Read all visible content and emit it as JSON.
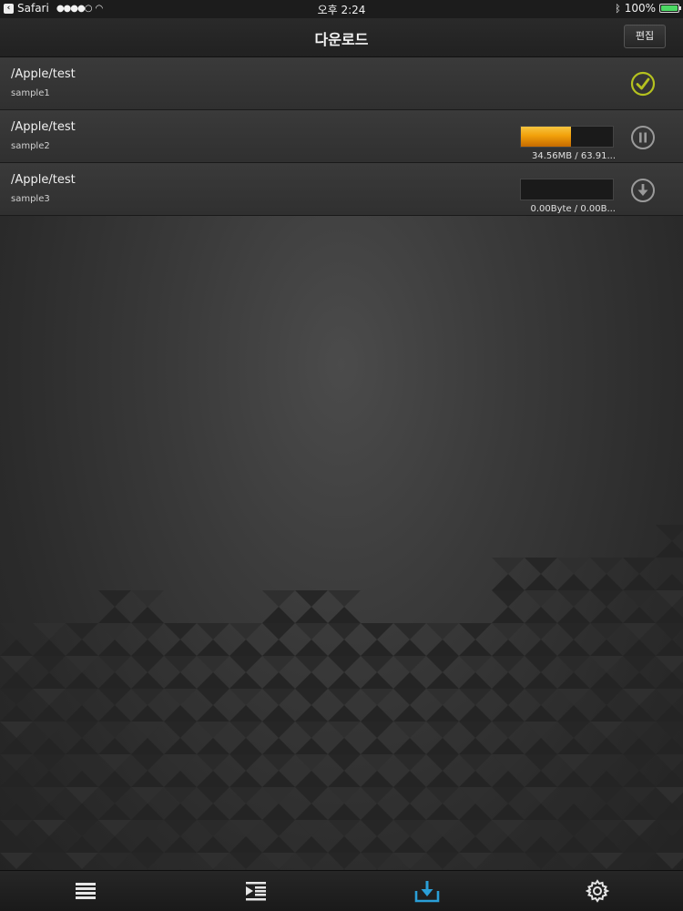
{
  "status_bar": {
    "back_app": "Safari",
    "time": "오후 2:24",
    "battery": "100%"
  },
  "nav": {
    "title": "다운로드",
    "edit_label": "편집"
  },
  "downloads": [
    {
      "path": "/Apple/test",
      "name": "sample1",
      "state": "completed",
      "icon": "checkmark-circle-icon"
    },
    {
      "path": "/Apple/test",
      "name": "sample2",
      "state": "downloading",
      "progress_text": "34.56MB / 63.91...",
      "progress": 0.54,
      "icon": "pause-circle-icon"
    },
    {
      "path": "/Apple/test",
      "name": "sample3",
      "state": "queued",
      "progress_text": "0.00Byte / 0.00B...",
      "progress": 0.0,
      "icon": "download-circle-icon"
    }
  ],
  "tabs": [
    {
      "icon": "list-icon",
      "active": false
    },
    {
      "icon": "indent-list-icon",
      "active": false
    },
    {
      "icon": "download-tray-icon",
      "active": true
    },
    {
      "icon": "gear-icon",
      "active": false
    }
  ],
  "colors": {
    "accent_active_tab": "#2a9fd8",
    "completed_check": "#b5c21f",
    "progress_fill": "#f2a00a"
  }
}
